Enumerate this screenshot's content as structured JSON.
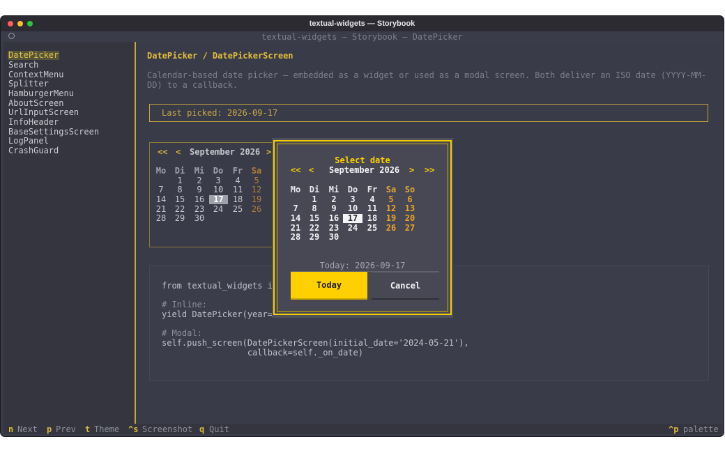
{
  "window": {
    "title": "textual-widgets — Storybook"
  },
  "app": {
    "subtitle": "textual-widgets — Storybook — DatePicker"
  },
  "sidebar": {
    "items": [
      "DatePicker",
      "Search",
      "ContextMenu",
      "Splitter",
      "HamburgerMenu",
      "AboutScreen",
      "UrlInputScreen",
      "InfoHeader",
      "BaseSettingsScreen",
      "LogPanel",
      "CrashGuard"
    ],
    "active": "DatePicker"
  },
  "main": {
    "breadcrumb": "DatePicker / DatePickerScreen",
    "description": "Calendar-based date picker — embedded as a widget or used as a modal screen. Both deliver an ISO date (YYYY-MM-DD) to a callback.",
    "last_picked": "Last picked: 2026-09-17"
  },
  "inline_calendar": {
    "nav_first": "<<",
    "nav_prev": "<",
    "month": "September 2026",
    "nav_next": ">",
    "weekdays": [
      "Mo",
      "Di",
      "Mi",
      "Do",
      "Fr",
      "Sa"
    ],
    "weeks": [
      [
        "",
        "1",
        "2",
        "3",
        "4",
        "5"
      ],
      [
        "7",
        "8",
        "9",
        "10",
        "11",
        "12"
      ],
      [
        "14",
        "15",
        "16",
        "17",
        "18",
        "19"
      ],
      [
        "21",
        "22",
        "23",
        "24",
        "25",
        "26"
      ],
      [
        "28",
        "29",
        "30",
        "",
        "",
        ""
      ]
    ],
    "selected": "17"
  },
  "code": {
    "lines": [
      "from textual_widgets im",
      "",
      "# Inline:",
      "yield DatePicker(year=2",
      "",
      "# Modal:",
      "self.push_screen(DatePickerScreen(initial_date='2024-05-21'),",
      "                 callback=self._on_date)"
    ]
  },
  "dialog": {
    "title": "Select date",
    "nav_first": "<<",
    "nav_prev": "<",
    "month": "September 2026",
    "nav_next": ">",
    "nav_last": ">>",
    "weekdays": [
      "Mo",
      "Di",
      "Mi",
      "Do",
      "Fr",
      "Sa",
      "So"
    ],
    "weeks": [
      [
        "",
        "1",
        "2",
        "3",
        "4",
        "5",
        "6"
      ],
      [
        "7",
        "8",
        "9",
        "10",
        "11",
        "12",
        "13"
      ],
      [
        "14",
        "15",
        "16",
        "17",
        "18",
        "19",
        "20"
      ],
      [
        "21",
        "22",
        "23",
        "24",
        "25",
        "26",
        "27"
      ],
      [
        "28",
        "29",
        "30",
        "",
        "",
        "",
        ""
      ]
    ],
    "selected": "17",
    "today_text": "Today: 2026-09-17",
    "today_button": "Today",
    "cancel_button": "Cancel"
  },
  "footer": {
    "bindings": [
      {
        "key": "n",
        "label": "Next"
      },
      {
        "key": "p",
        "label": "Prev"
      },
      {
        "key": "t",
        "label": "Theme"
      },
      {
        "key": "^s",
        "label": "Screenshot"
      },
      {
        "key": "q",
        "label": "Quit"
      }
    ],
    "palette_key": "^p",
    "palette_label": "palette"
  },
  "colors": {
    "accent": "#ffd000",
    "brand_gold": "#e2bd3d",
    "weekend": "#e9a12a",
    "background": "#3a3b48"
  }
}
